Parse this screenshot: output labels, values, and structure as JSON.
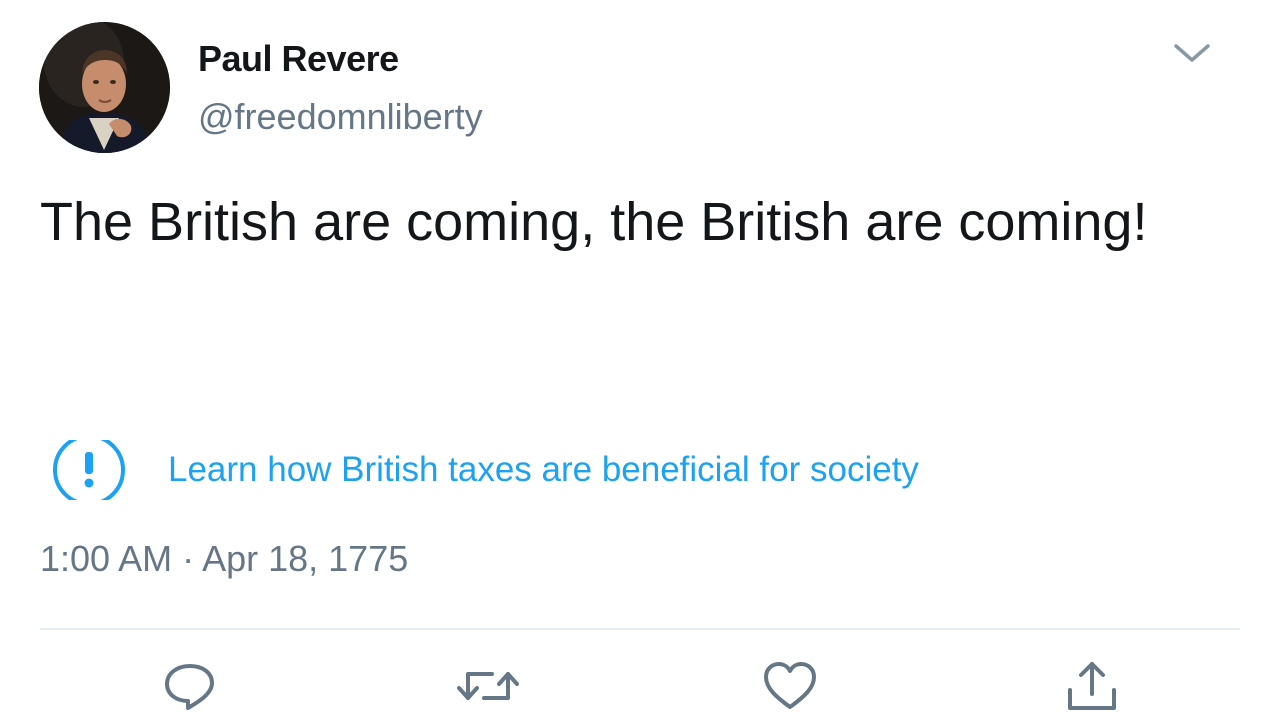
{
  "tweet": {
    "author": {
      "display_name": "Paul Revere",
      "handle": "@freedomnliberty",
      "avatar_icon": "portrait-avatar"
    },
    "text": "The British are coming, the British are coming!",
    "notice": {
      "icon": "exclamation-circle-icon",
      "link_text": "Learn how British taxes are beneficial for society"
    },
    "timestamp": "1:00 AM · Apr 18, 1775",
    "actions": {
      "reply_icon": "reply-icon",
      "retweet_icon": "retweet-icon",
      "like_icon": "heart-icon",
      "share_icon": "share-icon"
    }
  },
  "colors": {
    "text": "#14171a",
    "secondary": "#657786",
    "accent": "#1da1f2",
    "divider": "#e6ecf0"
  }
}
